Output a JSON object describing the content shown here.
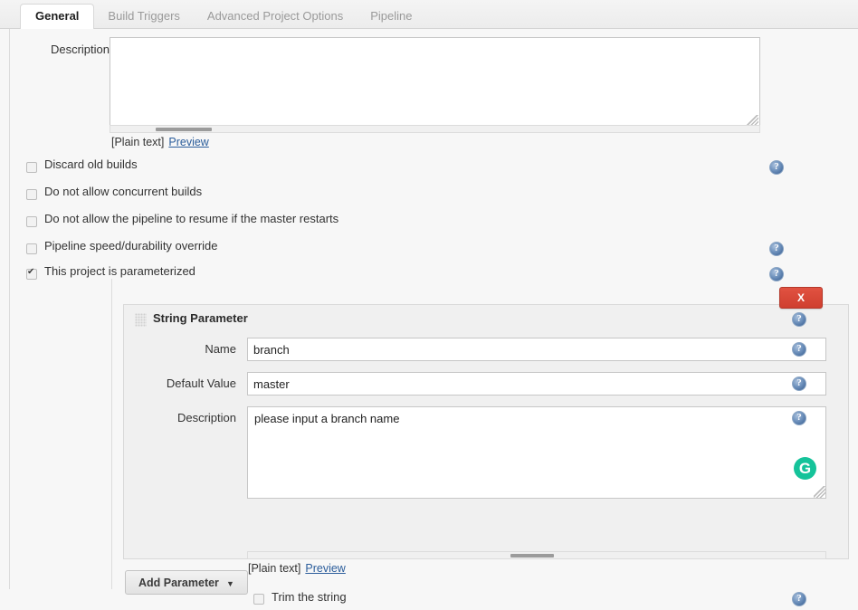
{
  "tabs": [
    {
      "label": "General",
      "active": true
    },
    {
      "label": "Build Triggers",
      "active": false
    },
    {
      "label": "Advanced Project Options",
      "active": false
    },
    {
      "label": "Pipeline",
      "active": false
    }
  ],
  "description_field": {
    "label": "Description",
    "value": "",
    "markup_note": "[Plain text]",
    "preview_link": "Preview"
  },
  "options": [
    {
      "label": "Discard old builds",
      "checked": false,
      "help": true
    },
    {
      "label": "Do not allow concurrent builds",
      "checked": false,
      "help": false
    },
    {
      "label": "Do not allow the pipeline to resume if the master restarts",
      "checked": false,
      "help": false
    },
    {
      "label": "Pipeline speed/durability override",
      "checked": false,
      "help": true
    },
    {
      "label": "This project is parameterized",
      "checked": true,
      "help": true
    }
  ],
  "parameter": {
    "title": "String Parameter",
    "delete_label": "X",
    "name": {
      "label": "Name",
      "value": "branch"
    },
    "default_value": {
      "label": "Default Value",
      "value": "master"
    },
    "description": {
      "label": "Description",
      "value": "please input a branch name",
      "markup_note": "[Plain text]",
      "preview_link": "Preview"
    },
    "trim": {
      "label": "Trim the string",
      "checked": false
    },
    "grammarly_badge": "G"
  },
  "add_parameter_button": {
    "label": "Add Parameter",
    "caret": "▼"
  },
  "icons": {
    "help": "help-icon",
    "drag": "drag-handle-icon",
    "caret": "chevron-down-icon"
  },
  "colors": {
    "accent_link": "#2b5d9b",
    "delete_red": "#cf3f2f",
    "grammarly_green": "#15c39a",
    "help_blue": "#4f74a4"
  }
}
